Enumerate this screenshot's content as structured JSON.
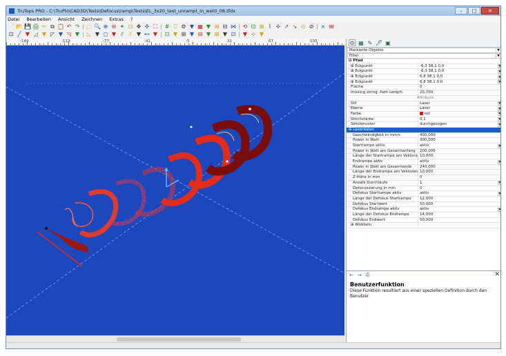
{
  "window": {
    "title": "TruTops PRO - C:\\TruPlo\\CAD3D\\Tests\\Defocus\\ramp\\Tests\\EL_3x20_test_unrampt_in_wetti_08.tfdx",
    "min": "–",
    "max": "□",
    "close": "✕"
  },
  "menu": [
    "Datei",
    "Bearbeiten",
    "Ansicht",
    "Zeichnen",
    "Extras",
    "?"
  ],
  "toolbar_row1": [
    "📄",
    "📂",
    "💾",
    "🖨",
    "✂",
    "⧉",
    "📋",
    "↶",
    "↷",
    "⬚",
    "🔍",
    "⊕",
    "⊖",
    "✦",
    "⊡",
    "✥",
    "✣",
    "⛶",
    "#",
    "⎕",
    "⚙",
    "▼",
    "▦",
    "▼",
    "⊞",
    "⊟",
    "⋈",
    "⟲",
    "⊡",
    "⊠",
    "⌇",
    "✢",
    "↗",
    "↘",
    "⊙",
    "⊘",
    "⨯",
    "⊞"
  ],
  "toolbar_row2": [
    "⊡",
    "╱",
    "▼",
    "◿",
    "▼",
    "◸",
    "▼",
    "◹",
    "▼",
    "◺",
    "▼",
    "◻",
    "▼",
    "⫽",
    "⫽",
    "▼",
    "⊷",
    "▼",
    "⊡",
    "▼",
    "⊞",
    "▼",
    "⊟",
    "▼",
    "⊠",
    "▼",
    "⊡",
    "▼",
    "⊹",
    "▼"
  ],
  "ruler": {
    "labels": [
      "-149",
      "-113",
      "-77",
      "-41",
      "-5",
      "31",
      "67",
      "103"
    ]
  },
  "panel": {
    "tabs": [
      "⚙",
      "▦",
      "✎",
      "🖊",
      "▣"
    ],
    "selection_label": "Markierte Objekte",
    "filter_label": "Filter",
    "rows": [
      {
        "name": "⊟ Pfad",
        "value": "",
        "kind": "group"
      },
      {
        "name": "⊞ Eckpunkt",
        "value": "-6,3 38,1 0,0",
        "kind": "indent1",
        "arrow": true
      },
      {
        "name": "⊞ Eckpunkt",
        "value": "-6,3 38,1 0,0",
        "kind": "indent1",
        "arrow": true
      },
      {
        "name": "⊞ Eckpunkt",
        "value": "6,8 38,1 0,0",
        "kind": "indent1",
        "arrow": true
      },
      {
        "name": "⊞ Eckpunkt",
        "value": "6,8 38,1 0,0",
        "kind": "indent1",
        "arrow": true
      },
      {
        "name": "Fläche",
        "value": "0",
        "kind": "indent1"
      },
      {
        "name": "missing string: Path Length",
        "value": "20,700",
        "kind": "indent1"
      },
      {
        "name": "Attribute",
        "value": "",
        "kind": "center"
      },
      {
        "name": "Stil",
        "value": "Laser",
        "kind": "indent1",
        "arrow": true
      },
      {
        "name": "Ebene",
        "value": "Laser",
        "kind": "indent1",
        "arrow": true
      },
      {
        "name": "Farbe",
        "value": "rot",
        "kind": "indent1",
        "arrow": true,
        "swatch": true
      },
      {
        "name": "Strichstärke",
        "value": "0,1",
        "kind": "indent1",
        "arrow": true
      },
      {
        "name": "Strichmuster",
        "value": "durchgezogen",
        "kind": "indent1",
        "arrow": true
      },
      {
        "name": "⊟ Laserdaten",
        "value": "",
        "kind": "selected"
      },
      {
        "name": "Geschwindigkeit in mm/s",
        "value": "400,000",
        "kind": "indent2"
      },
      {
        "name": "Power in Watt",
        "value": "300,000",
        "kind": "indent2"
      },
      {
        "name": "Startrampe aktiv",
        "value": "aktiv",
        "kind": "indent2",
        "arrow": true
      },
      {
        "name": "Power in Watt am Gesamtanfang",
        "value": "200,000",
        "kind": "indent2"
      },
      {
        "name": "Länge der Startrampe am Vektoranfang",
        "value": "10,000",
        "kind": "indent2"
      },
      {
        "name": "Endrampe aktiv",
        "value": "aktiv",
        "kind": "indent2",
        "arrow": true
      },
      {
        "name": "Power in Watt am Gesamtende",
        "value": "240,000",
        "kind": "indent2"
      },
      {
        "name": "Länge der Endrampe am Vektorende",
        "value": "10,000",
        "kind": "indent2"
      },
      {
        "name": "Z-Höhe in mm",
        "value": "0",
        "kind": "indent2"
      },
      {
        "name": "Anzahl Durchläufe",
        "value": "1",
        "kind": "indent2",
        "arrow": true
      },
      {
        "name": "Defocussierung in mm",
        "value": "0",
        "kind": "indent2"
      },
      {
        "name": "Defokus Startrampe aktiv",
        "value": "aktiv",
        "kind": "indent2",
        "arrow": true
      },
      {
        "name": "Länge der Defokus Startrampe",
        "value": "12,000",
        "kind": "indent2"
      },
      {
        "name": "Defokus Startwert",
        "value": "50,000",
        "kind": "indent2"
      },
      {
        "name": "Defokus Endrampe aktiv",
        "value": "aktiv",
        "kind": "indent2",
        "arrow": true
      },
      {
        "name": "Länge der Defokus Endrampe",
        "value": "14,000",
        "kind": "indent2"
      },
      {
        "name": "Defokus Endwert",
        "value": "50,000",
        "kind": "indent2"
      },
      {
        "name": "⊞ Wobbeln",
        "value": "",
        "kind": "indent1"
      }
    ]
  },
  "help": {
    "back": "←",
    "forward": "→",
    "print": "⎙",
    "close": "✕",
    "title": "Benutzerfunktion",
    "text": "Diese Funktion resultiert aus einer speziellen Definition durch den Benutzer"
  },
  "colors": {
    "canvas": "#1d47bd",
    "shape_red": "#e02a17",
    "selection": "#1560c8"
  }
}
